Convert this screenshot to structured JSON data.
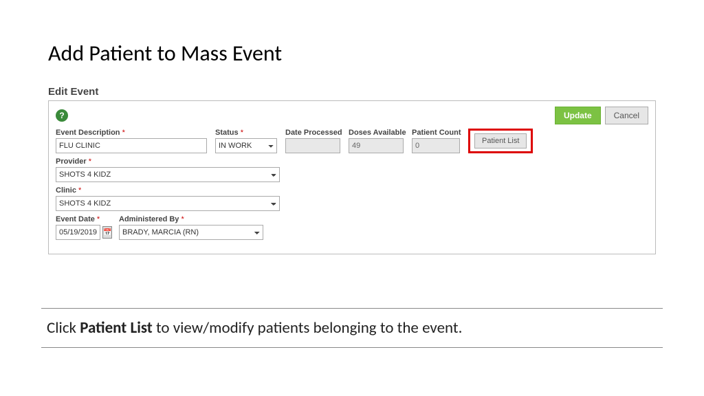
{
  "page": {
    "title": "Add Patient to Mass Event"
  },
  "form": {
    "heading": "Edit Event",
    "help_tooltip": "?",
    "buttons": {
      "update": "Update",
      "cancel": "Cancel",
      "patient_list": "Patient List"
    },
    "fields": {
      "event_description": {
        "label": "Event Description",
        "value": "FLU CLINIC"
      },
      "status": {
        "label": "Status",
        "value": "IN WORK"
      },
      "date_processed": {
        "label": "Date Processed",
        "value": ""
      },
      "doses_available": {
        "label": "Doses Available",
        "value": "49"
      },
      "patient_count": {
        "label": "Patient Count",
        "value": "0"
      },
      "provider": {
        "label": "Provider",
        "value": "SHOTS 4 KIDZ"
      },
      "clinic": {
        "label": "Clinic",
        "value": "SHOTS 4 KIDZ"
      },
      "event_date": {
        "label": "Event Date",
        "value": "05/19/2019"
      },
      "administered_by": {
        "label": "Administered By",
        "value": "BRADY, MARCIA (RN)"
      }
    },
    "required_mark": "*"
  },
  "instruction": {
    "prefix": "Click ",
    "bold": "Patient List",
    "suffix": " to view/modify patients belonging to the event."
  }
}
